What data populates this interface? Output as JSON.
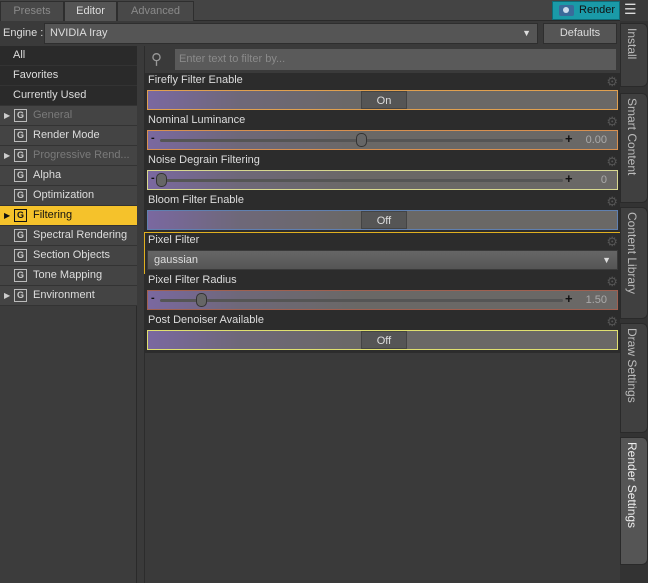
{
  "tabs": [
    "Presets",
    "Editor",
    "Advanced"
  ],
  "render_button": "Render",
  "engine": {
    "label": "Engine :",
    "value": "NVIDIA Iray",
    "defaults": "Defaults"
  },
  "left_list": {
    "top": [
      "All",
      "Favorites",
      "Currently Used"
    ],
    "groups": [
      {
        "label": "General",
        "expandable": true,
        "dim": true
      },
      {
        "label": "Render Mode",
        "expandable": false
      },
      {
        "label": "Progressive Rend...",
        "expandable": true,
        "dim": true
      },
      {
        "label": "Alpha",
        "expandable": false
      },
      {
        "label": "Optimization",
        "expandable": false
      },
      {
        "label": "Filtering",
        "expandable": true,
        "selected": true
      },
      {
        "label": "Spectral Rendering",
        "expandable": false
      },
      {
        "label": "Section Objects",
        "expandable": false
      },
      {
        "label": "Tone Mapping",
        "expandable": false
      },
      {
        "label": "Environment",
        "expandable": true
      }
    ]
  },
  "filter": {
    "placeholder": "Enter text to filter by..."
  },
  "params": [
    {
      "label": "Firefly Filter Enable",
      "type": "toggle",
      "value": "On"
    },
    {
      "label": "Nominal Luminance",
      "type": "slider",
      "value": "0.00",
      "fraction": 0.5
    },
    {
      "label": "Noise Degrain Filtering",
      "type": "slider",
      "value": "0",
      "fraction": 0.0
    },
    {
      "label": "Bloom Filter Enable",
      "type": "toggle",
      "value": "Off"
    },
    {
      "label": "Pixel Filter",
      "type": "dropdown",
      "value": "gaussian"
    },
    {
      "label": "Pixel Filter Radius",
      "type": "slider",
      "value": "1.50",
      "fraction": 0.1
    },
    {
      "label": "Post Denoiser Available",
      "type": "toggle",
      "value": "Off"
    }
  ],
  "side_tabs": [
    "Install",
    "Smart Content",
    "Content Library",
    "Draw Settings",
    "Render Settings"
  ],
  "colors": {
    "accent": "#f5c22b",
    "render": "#1a9aa8"
  }
}
